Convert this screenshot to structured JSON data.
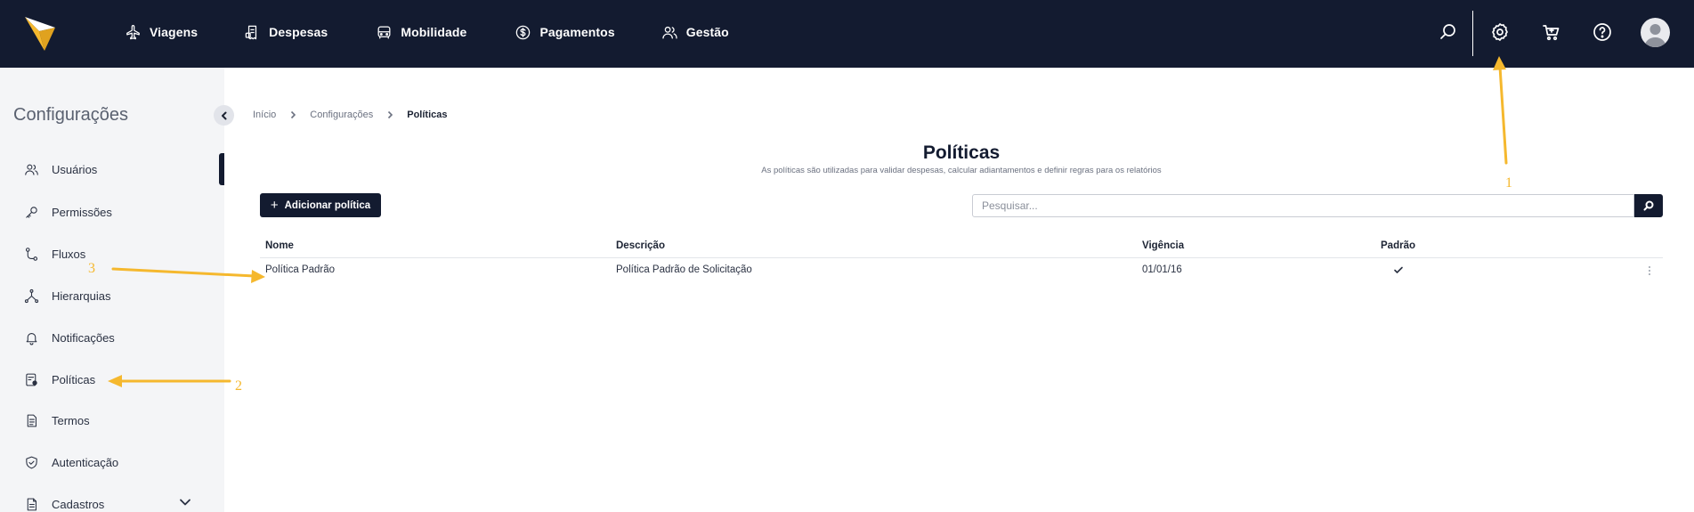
{
  "topbar": {
    "nav": [
      {
        "label": "Viagens",
        "icon": "airplane-icon"
      },
      {
        "label": "Despesas",
        "icon": "receipt-icon"
      },
      {
        "label": "Mobilidade",
        "icon": "car-icon"
      },
      {
        "label": "Pagamentos",
        "icon": "dollar-circle-icon"
      },
      {
        "label": "Gestão",
        "icon": "users-icon"
      }
    ],
    "icons": [
      "search-icon",
      "gear-icon",
      "cart-icon",
      "help-icon",
      "avatar"
    ]
  },
  "sidebar": {
    "title": "Configurações",
    "items": [
      {
        "label": "Usuários",
        "icon": "users-icon"
      },
      {
        "label": "Permissões",
        "icon": "key-icon"
      },
      {
        "label": "Fluxos",
        "icon": "flow-icon"
      },
      {
        "label": "Hierarquias",
        "icon": "hierarchy-icon"
      },
      {
        "label": "Notificações",
        "icon": "bell-icon"
      },
      {
        "label": "Políticas",
        "icon": "policy-icon"
      },
      {
        "label": "Termos",
        "icon": "document-icon"
      },
      {
        "label": "Autenticação",
        "icon": "shield-icon"
      },
      {
        "label": "Cadastros",
        "icon": "file-icon"
      }
    ]
  },
  "breadcrumb": [
    "Início",
    "Configurações",
    "Políticas"
  ],
  "page": {
    "title": "Políticas",
    "subtitle": "As políticas são utilizadas para validar despesas, calcular adiantamentos e definir regras para os relatórios",
    "add_button": "Adicionar política",
    "search_placeholder": "Pesquisar..."
  },
  "table": {
    "columns": [
      "Nome",
      "Descrição",
      "Vigência",
      "Padrão"
    ],
    "rows": [
      {
        "nome": "Política Padrão",
        "descricao": "Política Padrão de Solicitação",
        "vigencia": "01/01/16",
        "padrao": true
      }
    ]
  },
  "annotations": [
    "1",
    "2",
    "3"
  ],
  "colors": {
    "navy": "#131b30",
    "annotation": "#f5b82e",
    "sidebar_bg": "#f4f5f7"
  }
}
